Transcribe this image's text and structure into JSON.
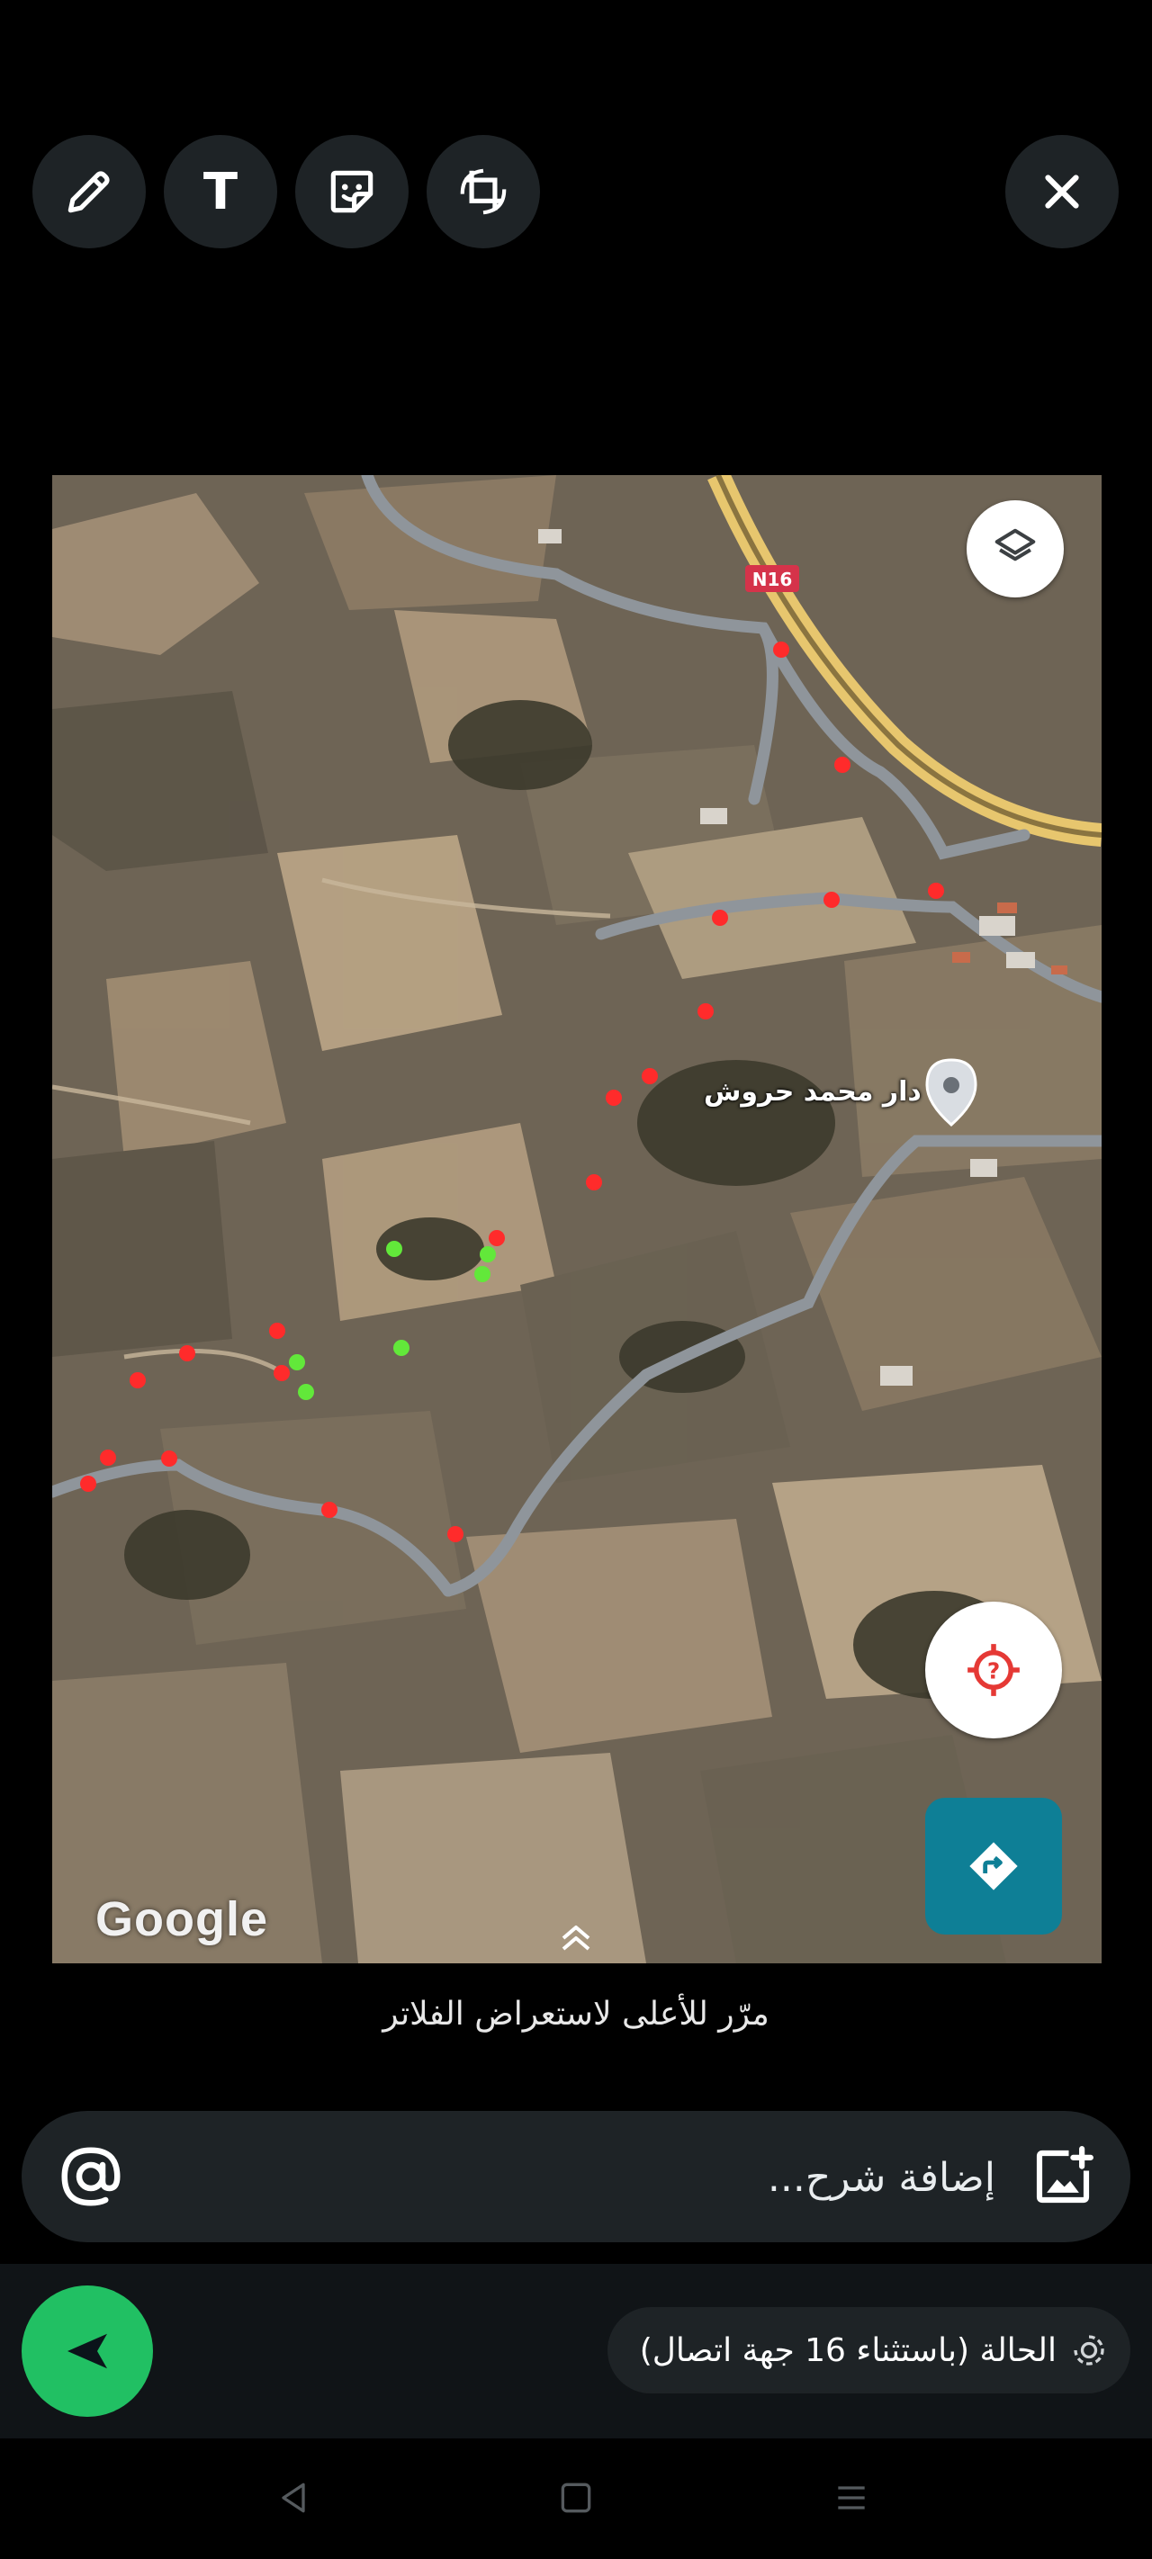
{
  "toolbar": {
    "tools": [
      {
        "name": "pencil-icon"
      },
      {
        "name": "text-icon",
        "glyph": "T"
      },
      {
        "name": "sticker-icon"
      },
      {
        "name": "crop-rotate-icon"
      }
    ],
    "close_icon": "close-icon"
  },
  "map": {
    "attribution": "Google",
    "road_label": "N16",
    "place_label": "دار محمد حروش",
    "colors": {
      "red_markers": "#ff2b2b",
      "green_markers": "#62e83a",
      "road": "#8f959b",
      "highway": "#e7c66e",
      "directions_button": "#0e7f96"
    },
    "buttons": {
      "layers": "layers-icon",
      "location": "location-icon",
      "directions": "directions-icon"
    }
  },
  "hint": {
    "filters": "مرّر للأعلى لاستعراض الفلاتر"
  },
  "caption": {
    "placeholder": "إضافة شرح...",
    "mention_icon": "at-icon",
    "media_icon": "add-image-icon"
  },
  "status": {
    "label": "الحالة (باستثناء 16 جهة اتصال)",
    "icon": "status-icon"
  },
  "send": {
    "icon": "send-icon",
    "color": "#21c063"
  },
  "navbar": {
    "back": "back-icon",
    "home": "home-icon",
    "recents": "recents-icon"
  }
}
